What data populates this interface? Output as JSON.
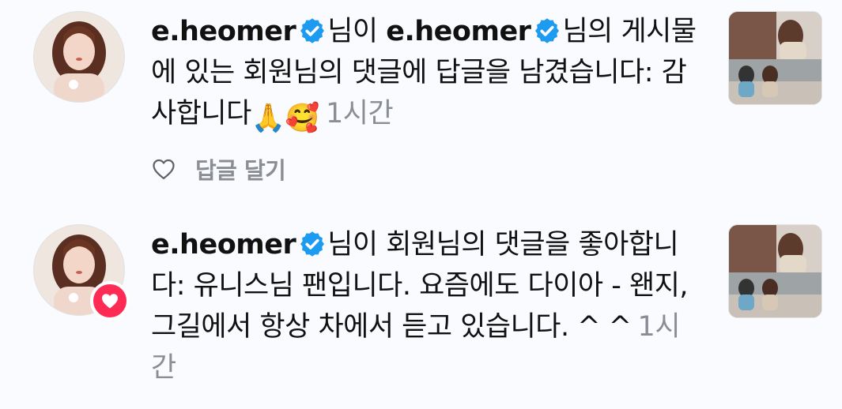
{
  "notifications": [
    {
      "username_1": "e.heomer",
      "text_1": "님이 ",
      "username_2": "e.heomer",
      "text_2": "님의 게시물에 있는 회원님의 댓글에 답글을 남겼습니다: 감사합니다",
      "emojis": "🙏🥰",
      "time": "1시간",
      "reply_label": "답글 달기",
      "icons": [
        "verified-badge",
        "heart-outline",
        "praying-hands-emoji",
        "smiling-face-with-hearts-emoji"
      ]
    },
    {
      "username_1": "e.heomer",
      "text_1": "님이 회원님의 댓글을 좋아합니다: 유니스님 팬입니다. 요즘에도 다이아 - 왠지, 그길에서 항상 차에서 듣고 있습니다. ^ ^",
      "time": "1시간",
      "icons": [
        "verified-badge",
        "heart-badge"
      ]
    }
  ],
  "colors": {
    "background": "#f9fbfe",
    "verified": "#1d9bf0",
    "heart_badge": "#fe2c55",
    "secondary_text": "#8a8d93"
  }
}
